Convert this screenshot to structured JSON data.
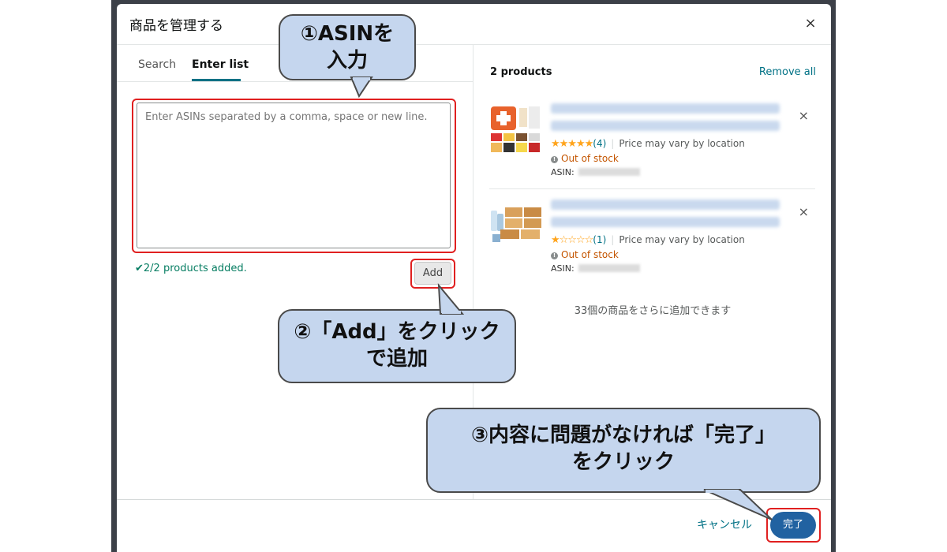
{
  "modal": {
    "title": "商品を管理する",
    "close_icon": "×"
  },
  "tabs": [
    {
      "label": "Search",
      "active": false
    },
    {
      "label": "Enter list",
      "active": true
    }
  ],
  "input": {
    "placeholder": "Enter ASINs separated by a comma, space or new line.",
    "value": ""
  },
  "status": {
    "check_icon": "✔",
    "message": "2/2 products added."
  },
  "add_button": {
    "label": "Add"
  },
  "products_panel": {
    "count_label": "2 products",
    "remove_all": "Remove all",
    "capacity_note": "33個の商品をさらに追加できます",
    "items": [
      {
        "stars": "★★★★★",
        "rating": 5,
        "review_count": "(4)",
        "price_note": "Price may vary by location",
        "stock": "Out of stock",
        "asin_label": "ASIN:",
        "remove_icon": "×"
      },
      {
        "stars": "★☆☆☆☆",
        "rating": 1,
        "review_count": "(1)",
        "price_note": "Price may vary by location",
        "stock": "Out of stock",
        "asin_label": "ASIN:",
        "remove_icon": "×"
      }
    ]
  },
  "footer": {
    "cancel": "キャンセル",
    "done": "完了"
  },
  "callouts": {
    "step1_line1": "①ASINを",
    "step1_line2": "入力",
    "step2_line1": "②「Add」をクリック",
    "step2_line2": "で追加",
    "step3_line1": "③内容に問題がなければ「完了」",
    "step3_line2": "をクリック"
  },
  "colors": {
    "accent": "#007185",
    "primary_button": "#2162a1",
    "success": "#067d62",
    "warning": "#c45500",
    "star": "#ffa41c",
    "highlight": "#e02020",
    "callout_fill": "#c5d6ee"
  }
}
